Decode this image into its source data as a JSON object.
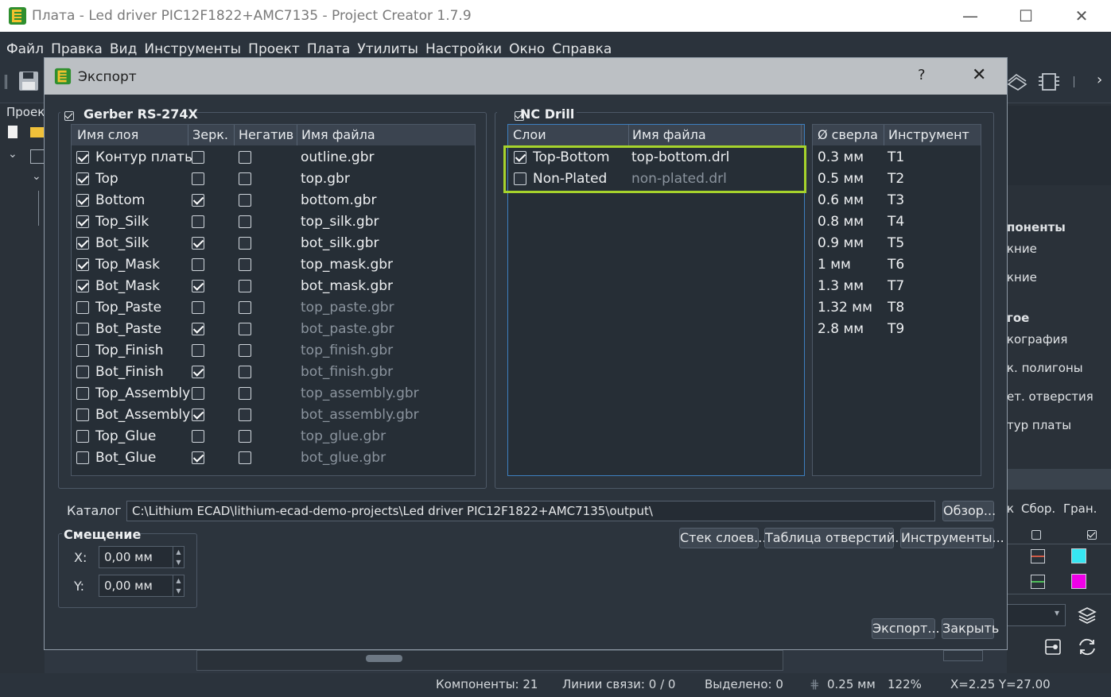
{
  "app": {
    "title": "Плата - Led driver PIC12F1822+AMC7135 - Project Creator 1.7.9",
    "menu": [
      "Файл",
      "Правка",
      "Вид",
      "Инструменты",
      "Проект",
      "Плата",
      "Утилиты",
      "Настройки",
      "Окно",
      "Справка"
    ],
    "window_controls": {
      "minimize": "—",
      "maximize": "☐",
      "close": "✕"
    },
    "left_panel_label": "Проек",
    "right_panel": {
      "section1_title": "поненты",
      "section1_items": [
        "кние",
        "кние"
      ],
      "section2_title": "гое",
      "section2_items": [
        "кография",
        "к. полигоны",
        "ет. отверстия",
        "тур платы"
      ],
      "col_headers": [
        "к",
        "Сбор.",
        "Гран."
      ]
    },
    "status": {
      "components": "Компоненты: 21",
      "links": "Линии связи: 0 / 0",
      "selected": "Выделено: 0",
      "grid": "0.25 мм",
      "zoom": "122%",
      "coords": "X=2.25  Y=27.00"
    }
  },
  "dialog": {
    "title": "Экспорт",
    "help": "?",
    "close": "✕",
    "gerber": {
      "title": "Gerber RS-274X",
      "enabled": true,
      "headers": [
        "Имя слоя",
        "Зерк.",
        "Негатив",
        "Имя файла"
      ],
      "rows": [
        {
          "layer": "Контур платы",
          "on": true,
          "mirror": false,
          "neg": false,
          "file": "outline.gbr"
        },
        {
          "layer": "Top",
          "on": true,
          "mirror": false,
          "neg": false,
          "file": "top.gbr"
        },
        {
          "layer": "Bottom",
          "on": true,
          "mirror": true,
          "neg": false,
          "file": "bottom.gbr"
        },
        {
          "layer": "Top_Silk",
          "on": true,
          "mirror": false,
          "neg": false,
          "file": "top_silk.gbr"
        },
        {
          "layer": "Bot_Silk",
          "on": true,
          "mirror": true,
          "neg": false,
          "file": "bot_silk.gbr"
        },
        {
          "layer": "Top_Mask",
          "on": true,
          "mirror": false,
          "neg": false,
          "file": "top_mask.gbr"
        },
        {
          "layer": "Bot_Mask",
          "on": true,
          "mirror": true,
          "neg": false,
          "file": "bot_mask.gbr"
        },
        {
          "layer": "Top_Paste",
          "on": false,
          "mirror": false,
          "neg": false,
          "file": "top_paste.gbr"
        },
        {
          "layer": "Bot_Paste",
          "on": false,
          "mirror": true,
          "neg": false,
          "file": "bot_paste.gbr"
        },
        {
          "layer": "Top_Finish",
          "on": false,
          "mirror": false,
          "neg": false,
          "file": "top_finish.gbr"
        },
        {
          "layer": "Bot_Finish",
          "on": false,
          "mirror": true,
          "neg": false,
          "file": "bot_finish.gbr"
        },
        {
          "layer": "Top_Assembly",
          "on": false,
          "mirror": false,
          "neg": false,
          "file": "top_assembly.gbr"
        },
        {
          "layer": "Bot_Assembly",
          "on": false,
          "mirror": true,
          "neg": false,
          "file": "bot_assembly.gbr"
        },
        {
          "layer": "Top_Glue",
          "on": false,
          "mirror": false,
          "neg": false,
          "file": "top_glue.gbr"
        },
        {
          "layer": "Bot_Glue",
          "on": false,
          "mirror": true,
          "neg": false,
          "file": "bot_glue.gbr"
        }
      ]
    },
    "drill": {
      "title": "NC Drill",
      "enabled": true,
      "headers": [
        "Слои",
        "Имя файла"
      ],
      "rows": [
        {
          "layer": "Top-Bottom",
          "on": true,
          "file": "top-bottom.drl"
        },
        {
          "layer": "Non-Plated",
          "on": false,
          "file": "non-plated.drl"
        }
      ],
      "tool_headers": [
        "Ø сверла",
        "Инструмент"
      ],
      "tools": [
        {
          "d": "0.3 мм",
          "t": "T1"
        },
        {
          "d": "0.5 мм",
          "t": "T2"
        },
        {
          "d": "0.6 мм",
          "t": "T3"
        },
        {
          "d": "0.8 мм",
          "t": "T4"
        },
        {
          "d": "0.9 мм",
          "t": "T5"
        },
        {
          "d": "1 мм",
          "t": "T6"
        },
        {
          "d": "1.3 мм",
          "t": "T7"
        },
        {
          "d": "1.32 мм",
          "t": "T8"
        },
        {
          "d": "2.8 мм",
          "t": "T9"
        }
      ]
    },
    "catalog_label": "Каталог",
    "catalog_path": "C:\\Lithium ECAD\\lithium-ecad-demo-projects\\Led driver PIC12F1822+AMC7135\\output\\",
    "browse": "Обзор...",
    "offset": {
      "title": "Смещение",
      "x_label": "X:",
      "x": "0,00 мм",
      "y_label": "Y:",
      "y": "0,00 мм"
    },
    "buttons": {
      "stack": "Стек слоев...",
      "holes": "Таблица отверстий...",
      "tools": "Инструменты...",
      "export": "Экспорт...",
      "close": "Закрыть"
    }
  }
}
